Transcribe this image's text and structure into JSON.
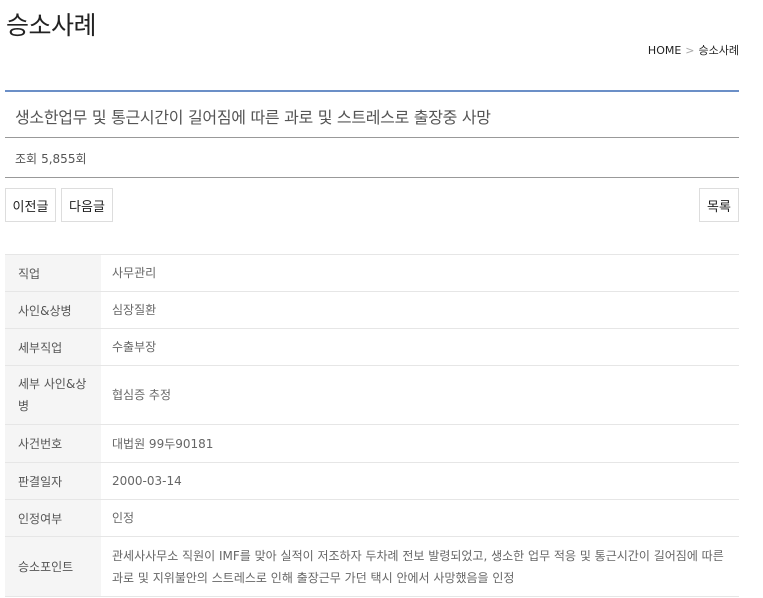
{
  "page_title": "승소사례",
  "breadcrumb": {
    "home": "HOME",
    "separator": ">",
    "current": "승소사례"
  },
  "post": {
    "title": "생소한업무 및 통근시간이 길어짐에 따른 과로 및 스트레스로 출장중 사망",
    "views_label": "조회",
    "views_value": "5,855회"
  },
  "buttons": {
    "prev": "이전글",
    "next": "다음글",
    "list": "목록"
  },
  "details": [
    {
      "label": "직업",
      "value": "사무관리"
    },
    {
      "label": "사인&상병",
      "value": "심장질환"
    },
    {
      "label": "세부직업",
      "value": "수출부장"
    },
    {
      "label": "세부 사인&상병",
      "value": "협심증 추정"
    },
    {
      "label": "사건번호",
      "value": "대법원 99두90181"
    },
    {
      "label": "판결일자",
      "value": "2000-03-14"
    },
    {
      "label": "인정여부",
      "value": "인정"
    },
    {
      "label": "승소포인트",
      "value": "관세사사무소 직원이 IMF를 맞아 실적이 저조하자 두차례 전보 발령되었고, 생소한 업무 적응 및 통근시간이 길어짐에 따른 과로 및 지위불안의 스트레스로 인해 출장근무 가던 택시 안에서 사망했음을 인정"
    }
  ]
}
